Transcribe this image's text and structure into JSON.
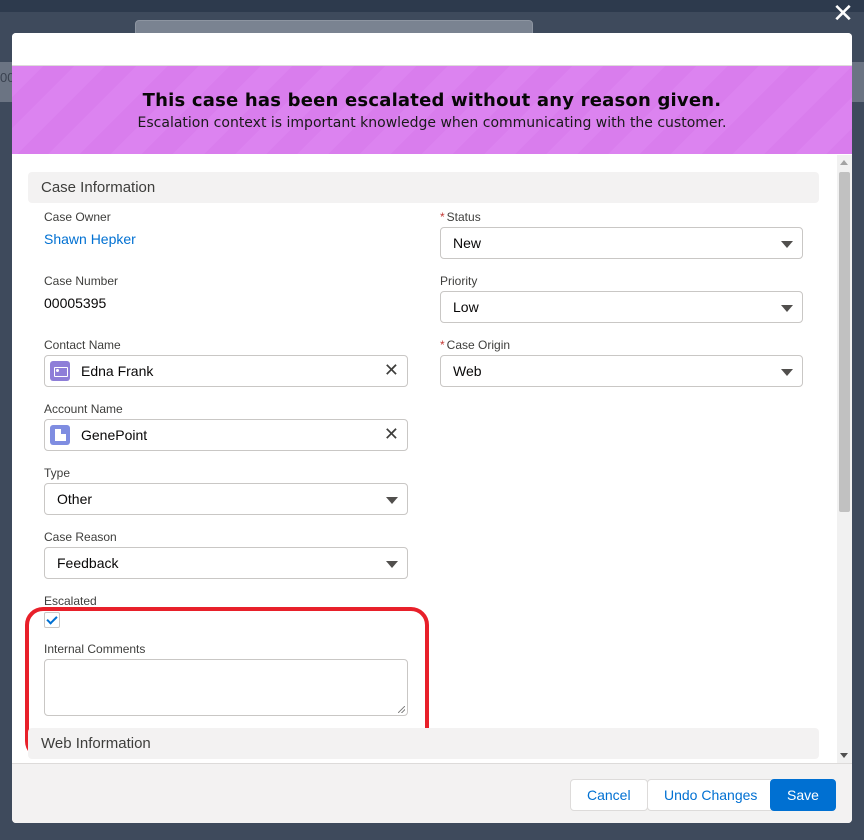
{
  "background": {
    "edge_text": "00"
  },
  "banner": {
    "title": "This case has been escalated without any reason given.",
    "subtitle": "Escalation context is important knowledge when communicating with the customer."
  },
  "sections": {
    "case_information": "Case Information",
    "web_information": "Web Information"
  },
  "fields": {
    "case_owner": {
      "label": "Case Owner",
      "value": "Shawn Hepker"
    },
    "status": {
      "label": "Status",
      "required": "*",
      "value": "New"
    },
    "case_number": {
      "label": "Case Number",
      "value": "00005395"
    },
    "priority": {
      "label": "Priority",
      "value": "Low"
    },
    "contact_name": {
      "label": "Contact Name",
      "value": "Edna Frank",
      "icon": "contact-icon"
    },
    "case_origin": {
      "label": "Case Origin",
      "required": "*",
      "value": "Web"
    },
    "account_name": {
      "label": "Account Name",
      "value": "GenePoint",
      "icon": "account-icon"
    },
    "type": {
      "label": "Type",
      "value": "Other"
    },
    "case_reason": {
      "label": "Case Reason",
      "value": "Feedback"
    },
    "escalated": {
      "label": "Escalated",
      "checked": true
    },
    "internal_comments": {
      "label": "Internal Comments",
      "value": ""
    }
  },
  "footer": {
    "cancel": "Cancel",
    "undo": "Undo Changes",
    "save": "Save"
  },
  "colors": {
    "banner_bg": "#dc83f0",
    "brand_blue": "#0070d2",
    "highlight_red": "#e8202a",
    "required_red": "#c23934"
  }
}
